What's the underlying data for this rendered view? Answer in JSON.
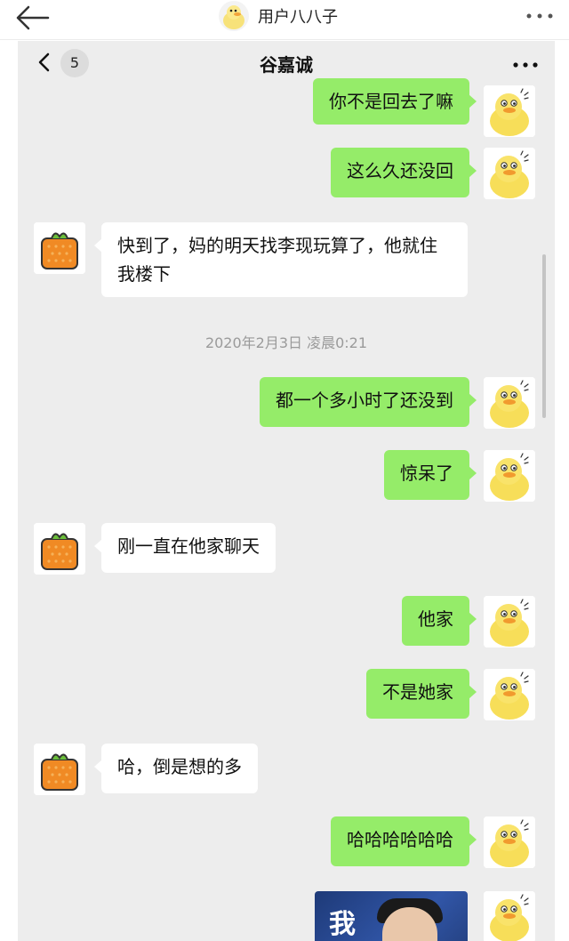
{
  "outer": {
    "username": "用户八八子"
  },
  "header": {
    "badge_count": "5",
    "title": "谷嘉诚"
  },
  "messages": [
    {
      "side": "right",
      "text": "你不是回去了嘛"
    },
    {
      "side": "right",
      "text": "这么久还没回"
    },
    {
      "side": "left",
      "text": "快到了，妈的明天找李现玩算了，他就住我楼下"
    },
    {
      "side": "time",
      "text": "2020年2月3日 凌晨0:21"
    },
    {
      "side": "right",
      "text": "都一个多小时了还没到"
    },
    {
      "side": "right",
      "text": "惊呆了"
    },
    {
      "side": "left",
      "text": "刚一直在他家聊天"
    },
    {
      "side": "right",
      "text": "他家"
    },
    {
      "side": "right",
      "text": "不是她家"
    },
    {
      "side": "left",
      "text": "哈，倒是想的多"
    },
    {
      "side": "right",
      "text": "哈哈哈哈哈哈"
    },
    {
      "side": "right",
      "image_text": "我"
    }
  ],
  "colors": {
    "sent_bubble": "#95ec69",
    "received_bubble": "#ffffff",
    "chat_background": "#ededed",
    "timestamp_text": "#9a9a9a"
  },
  "icons": {
    "outer_back": "arrow-left-icon",
    "outer_more": "more-dots-icon",
    "header_back": "chevron-left-icon",
    "header_more": "more-dots-icon",
    "sent_avatar": "yellow-duck-avatar",
    "received_avatar": "orange-gift-avatar"
  }
}
